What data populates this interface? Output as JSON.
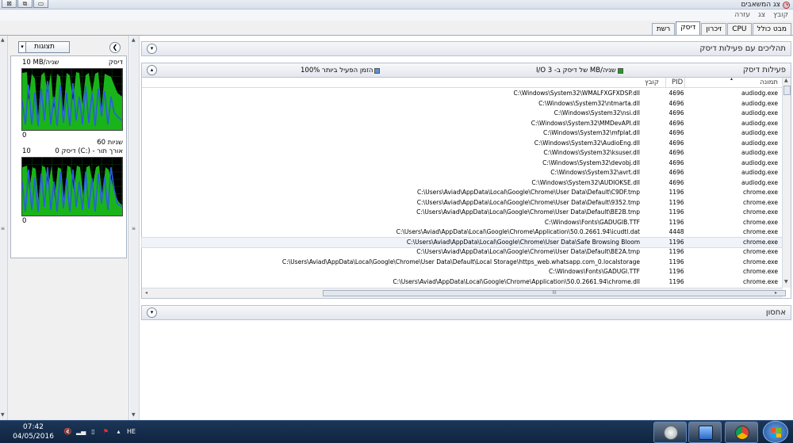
{
  "window": {
    "title": "צג המשאבים",
    "btn_close": "⊠",
    "btn_restore": "⧉",
    "btn_minimize": "▭"
  },
  "menu": [
    "קובץ",
    "צג",
    "עזרה"
  ],
  "tabs": [
    {
      "label": "מבט כולל",
      "active": false
    },
    {
      "label": "CPU",
      "active": false
    },
    {
      "label": "זיכרון",
      "active": false
    },
    {
      "label": "דיסק",
      "active": true
    },
    {
      "label": "רשת",
      "active": false
    }
  ],
  "left_panel": {
    "views_label": "תצוגות",
    "disk_graph": {
      "title": "דיסק",
      "max_label": "10 MB/שניה",
      "min_label": "0",
      "time_label": "60 שניות"
    },
    "queue_graph": {
      "title": "דיסק 0 (C:) - אורך תור",
      "max_label": "10",
      "min_label": "0"
    }
  },
  "sections": {
    "processes": {
      "title": "תהליכים עם פעילות דיסק"
    },
    "activity": {
      "title": "פעילות דיסק",
      "legend_io": "I/O של דיסק ב- 3 MB/שניה",
      "legend_io_color": "#1aa31a",
      "legend_active": "100% הזמן הפעיל ביותר",
      "legend_active_color": "#5b8fd6"
    },
    "storage": {
      "title": "אחסון"
    }
  },
  "table": {
    "headers": {
      "image": "תמונה",
      "pid": "PID",
      "file": "קובץ"
    },
    "rows": [
      {
        "image": "audiodg.exe",
        "pid": "4696",
        "file": "C:\\Windows\\System32\\WMALFXGFXDSP.dll"
      },
      {
        "image": "audiodg.exe",
        "pid": "4696",
        "file": "C:\\Windows\\System32\\ntmarta.dll"
      },
      {
        "image": "audiodg.exe",
        "pid": "4696",
        "file": "C:\\Windows\\System32\\nsi.dll"
      },
      {
        "image": "audiodg.exe",
        "pid": "4696",
        "file": "C:\\Windows\\System32\\MMDevAPI.dll"
      },
      {
        "image": "audiodg.exe",
        "pid": "4696",
        "file": "C:\\Windows\\System32\\mfplat.dll"
      },
      {
        "image": "audiodg.exe",
        "pid": "4696",
        "file": "C:\\Windows\\System32\\AudioEng.dll"
      },
      {
        "image": "audiodg.exe",
        "pid": "4696",
        "file": "C:\\Windows\\System32\\ksuser.dll"
      },
      {
        "image": "audiodg.exe",
        "pid": "4696",
        "file": "C:\\Windows\\System32\\devobj.dll"
      },
      {
        "image": "audiodg.exe",
        "pid": "4696",
        "file": "C:\\Windows\\System32\\avrt.dll"
      },
      {
        "image": "audiodg.exe",
        "pid": "4696",
        "file": "C:\\Windows\\System32\\AUDIOKSE.dll"
      },
      {
        "image": "chrome.exe",
        "pid": "1196",
        "file": "C:\\Users\\Aviad\\AppData\\Local\\Google\\Chrome\\User Data\\Default\\C9DF.tmp"
      },
      {
        "image": "chrome.exe",
        "pid": "1196",
        "file": "C:\\Users\\Aviad\\AppData\\Local\\Google\\Chrome\\User Data\\Default\\9352.tmp"
      },
      {
        "image": "chrome.exe",
        "pid": "1196",
        "file": "C:\\Users\\Aviad\\AppData\\Local\\Google\\Chrome\\User Data\\Default\\BE2B.tmp"
      },
      {
        "image": "chrome.exe",
        "pid": "1196",
        "file": "C:\\Windows\\Fonts\\GADUGIB.TTF"
      },
      {
        "image": "chrome.exe",
        "pid": "4448",
        "file": "C:\\Users\\Aviad\\AppData\\Local\\Google\\Chrome\\Application\\50.0.2661.94\\icudtl.dat"
      },
      {
        "image": "chrome.exe",
        "pid": "1196",
        "file": "C:\\Users\\Aviad\\AppData\\Local\\Google\\Chrome\\User Data\\Safe Browsing Bloom",
        "selected": true
      },
      {
        "image": "chrome.exe",
        "pid": "1196",
        "file": "C:\\Users\\Aviad\\AppData\\Local\\Google\\Chrome\\User Data\\Default\\BE2A.tmp"
      },
      {
        "image": "chrome.exe",
        "pid": "1196",
        "file": "C:\\Users\\Aviad\\AppData\\Local\\Google\\Chrome\\User Data\\Default\\Local Storage\\https_web.whatsapp.com_0.localstorage"
      },
      {
        "image": "chrome.exe",
        "pid": "1196",
        "file": "C:\\Windows\\Fonts\\GADUGI.TTF"
      },
      {
        "image": "chrome.exe",
        "pid": "1196",
        "file": "C:\\Users\\Aviad\\AppData\\Local\\Google\\Chrome\\Application\\50.0.2661.94\\chrome.dll"
      }
    ]
  },
  "taskbar": {
    "time": "07:42",
    "date": "04/05/2016",
    "lang": "HE"
  }
}
